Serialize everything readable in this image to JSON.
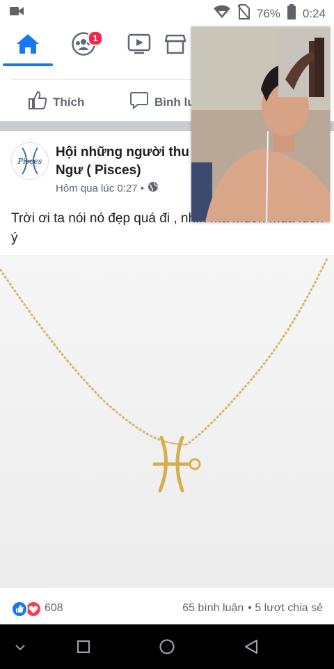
{
  "status_bar": {
    "battery": "76%",
    "time": "0:24"
  },
  "nav": {
    "groups_badge": "1"
  },
  "prev_post_actions": {
    "like": "Thích",
    "comment": "Bình lu"
  },
  "post": {
    "group_name": "Hội những người thu\nNgư ( Pisces)",
    "avatar_text": "Pisces",
    "timestamp": "Hôm qua lúc 0:27 •",
    "text": "Trời ơi ta nói nó đẹp quá đi , nhìn mà muốn mua luôn ý",
    "reactions_count": "608",
    "comments": "65 bình luận",
    "shares": "• 5 lượt chia sẻ"
  },
  "colors": {
    "accent": "#1877f2",
    "badge": "#f02849",
    "love": "#f33e58"
  },
  "icons": [
    "video-camera-icon",
    "wifi-icon",
    "no-sim-icon",
    "battery-icon",
    "home-icon",
    "groups-icon",
    "watch-icon",
    "marketplace-icon",
    "like-icon",
    "comment-icon",
    "globe-icon",
    "back-icon",
    "home-nav-icon",
    "recents-icon",
    "chevron-down-icon"
  ]
}
